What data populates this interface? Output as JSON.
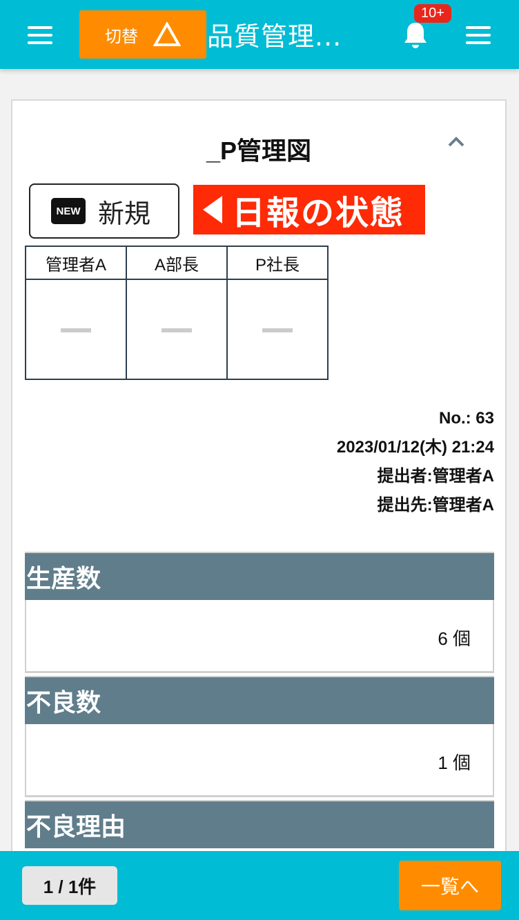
{
  "header": {
    "switch_label": "切替",
    "switch_icon": "triangle-outline-icon",
    "title": "品質管理...",
    "notification_badge": "10+",
    "bell_icon": "bell-icon",
    "menu_icon": "hamburger-menu-icon"
  },
  "report": {
    "title": "_P管理図",
    "collapse_icon": "chevron-up-icon",
    "new_button": {
      "icon_text": "NEW",
      "label": "新規"
    },
    "status_banner": "日報の状態",
    "approvers": [
      {
        "name": "管理者A",
        "stamp": ""
      },
      {
        "name": "A部長",
        "stamp": ""
      },
      {
        "name": "P社長",
        "stamp": ""
      }
    ],
    "meta": {
      "number": "No.: 63",
      "datetime": "2023/01/12(木) 21:24",
      "submitter": "提出者:管理者A",
      "recipient": "提出先:管理者A"
    },
    "sections": [
      {
        "label": "生産数",
        "value": "6 個"
      },
      {
        "label": "不良数",
        "value": "1 個"
      },
      {
        "label": "不良理由",
        "value": ""
      }
    ]
  },
  "footer": {
    "pager": "1 / 1件",
    "list_button": "一覧へ"
  },
  "colors": {
    "header_bg": "#00bcd4",
    "accent_orange": "#ff8c00",
    "status_red": "#ff2a06",
    "section_head": "#607d8b",
    "badge_red": "#e8271c"
  }
}
